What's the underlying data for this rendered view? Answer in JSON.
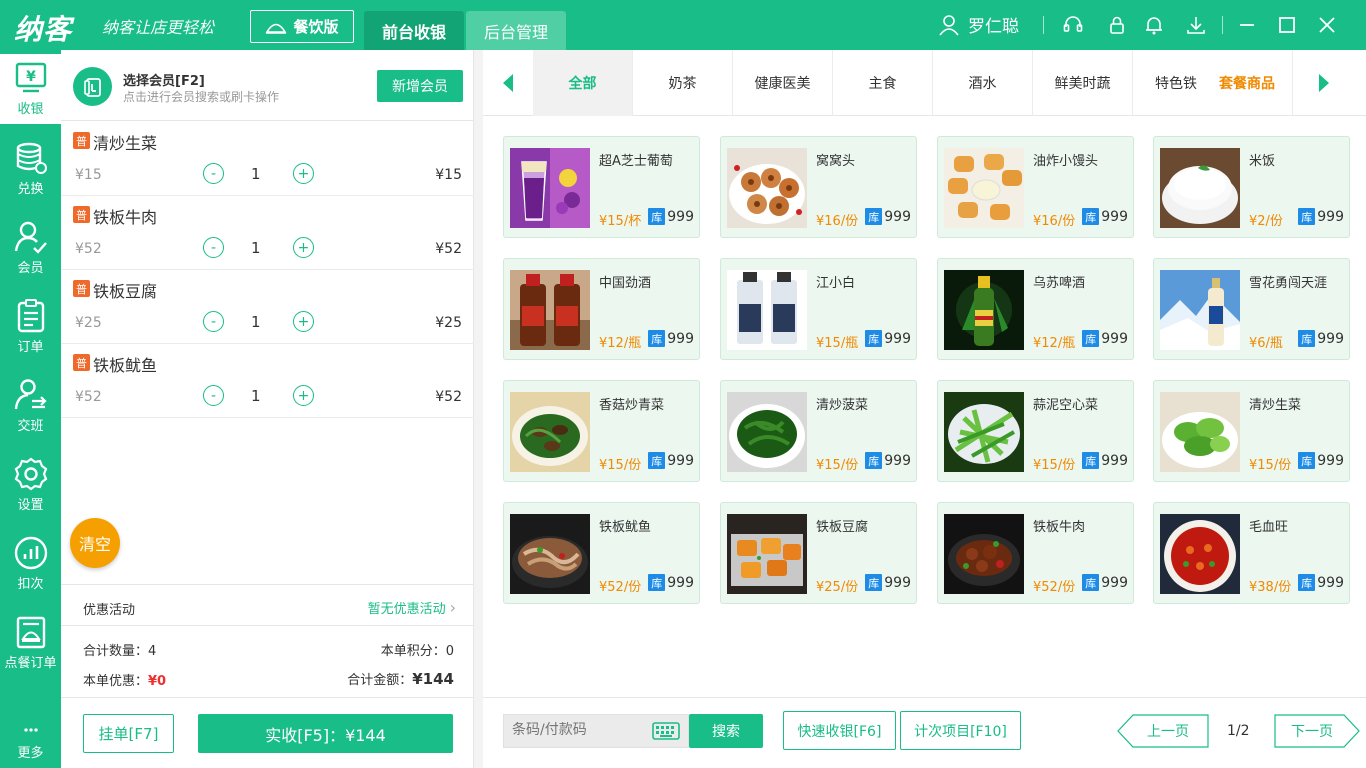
{
  "app": {
    "logo": "纳客",
    "slogan": "纳客让店更轻松",
    "edition": "餐饮版",
    "tabs": [
      "前台收银",
      "后台管理"
    ],
    "user": "罗仁聪"
  },
  "nav": [
    {
      "label": "收银",
      "icon": "cashier-icon"
    },
    {
      "label": "兑换",
      "icon": "exchange-icon"
    },
    {
      "label": "会员",
      "icon": "member-icon"
    },
    {
      "label": "订单",
      "icon": "order-icon"
    },
    {
      "label": "交班",
      "icon": "shift-icon"
    },
    {
      "label": "设置",
      "icon": "gear-icon"
    },
    {
      "label": "扣次",
      "icon": "deduct-icon"
    },
    {
      "label": "点餐订单",
      "icon": "dish-order-icon"
    },
    {
      "label": "更多",
      "icon": "more-icon"
    }
  ],
  "member": {
    "title": "选择会员[F2]",
    "subtitle": "点击进行会员搜索或刷卡操作",
    "new_button": "新增会员"
  },
  "cart": {
    "badge": "普",
    "items": [
      {
        "name": "清炒生菜",
        "price": "¥15",
        "qty": "1",
        "total": "¥15"
      },
      {
        "name": "铁板牛肉",
        "price": "¥52",
        "qty": "1",
        "total": "¥52"
      },
      {
        "name": "铁板豆腐",
        "price": "¥25",
        "qty": "1",
        "total": "¥25"
      },
      {
        "name": "铁板鱿鱼",
        "price": "¥52",
        "qty": "1",
        "total": "¥52"
      }
    ],
    "clear": "清空",
    "promo_label": "优惠活动",
    "promo_value": "暂无优惠活动",
    "count_label": "合计数量：",
    "count_value": "4",
    "points_label": "本单积分：",
    "points_value": "0",
    "discount_label": "本单优惠：",
    "discount_value": "¥0",
    "total_label": "合计金额：",
    "total_value": "¥144",
    "hang_button": "挂单[F7]",
    "pay_button": "实收[F5]：¥144"
  },
  "categories": [
    "全部",
    "奶茶",
    "健康医美",
    "主食",
    "酒水",
    "鲜美时蔬",
    "特色铁",
    "套餐商品"
  ],
  "stock_badge": "库",
  "products": [
    {
      "name": "超A芝士葡萄",
      "price": "¥15/杯",
      "stock": "999"
    },
    {
      "name": "窝窝头",
      "price": "¥16/份",
      "stock": "999"
    },
    {
      "name": "油炸小馒头",
      "price": "¥16/份",
      "stock": "999"
    },
    {
      "name": "米饭",
      "price": "¥2/份",
      "stock": "999"
    },
    {
      "name": "中国劲酒",
      "price": "¥12/瓶",
      "stock": "999"
    },
    {
      "name": "江小白",
      "price": "¥15/瓶",
      "stock": "999"
    },
    {
      "name": "乌苏啤酒",
      "price": "¥12/瓶",
      "stock": "999"
    },
    {
      "name": "雪花勇闯天涯",
      "price": "¥6/瓶",
      "stock": "999"
    },
    {
      "name": "香菇炒青菜",
      "price": "¥15/份",
      "stock": "999"
    },
    {
      "name": "清炒菠菜",
      "price": "¥15/份",
      "stock": "999"
    },
    {
      "name": "蒜泥空心菜",
      "price": "¥15/份",
      "stock": "999"
    },
    {
      "name": "清炒生菜",
      "price": "¥15/份",
      "stock": "999"
    },
    {
      "name": "铁板鱿鱼",
      "price": "¥52/份",
      "stock": "999"
    },
    {
      "name": "铁板豆腐",
      "price": "¥25/份",
      "stock": "999"
    },
    {
      "name": "铁板牛肉",
      "price": "¥52/份",
      "stock": "999"
    },
    {
      "name": "毛血旺",
      "price": "¥38/份",
      "stock": "999"
    }
  ],
  "bottom": {
    "search_placeholder": "条码/付款码",
    "search_button": "搜索",
    "quick_button": "快速收银[F6]",
    "count_button": "计次项目[F10]",
    "prev": "上一页",
    "page": "1/2",
    "next": "下一页"
  },
  "colors": {
    "brand": "#19bd87",
    "accent": "#f08a00",
    "stock": "#1e8be6",
    "danger": "#ef2f2f"
  }
}
